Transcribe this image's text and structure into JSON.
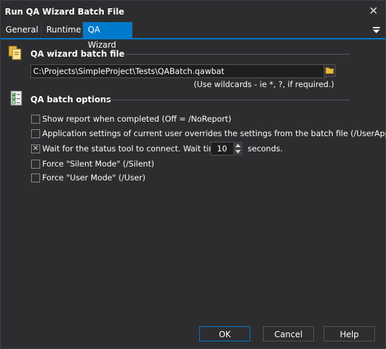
{
  "window": {
    "title": "Run QA Wizard Batch File"
  },
  "tabs": [
    {
      "label": "General"
    },
    {
      "label": "Runtime"
    },
    {
      "label": "QA Wizard"
    }
  ],
  "file_section": {
    "title": "QA wizard batch file",
    "path_value": "C:\\Projects\\SimpleProject\\Tests\\QABatch.qawbat",
    "hint": "(Use wildcards - ie *, ?, if required.)"
  },
  "options_section": {
    "title": "QA batch options",
    "options": [
      {
        "label": "Show report when completed (Off = /NoReport)",
        "checked": false
      },
      {
        "label": "Application settings of current user overrides the settings from the batch file (/UserApp)",
        "checked": false
      },
      {
        "label": "Wait for the status tool to connect. Wait timeout:",
        "checked": true
      },
      {
        "label": "Force \"Silent Mode\" (/Silent)",
        "checked": false
      },
      {
        "label": "Force \"User Mode\" (/User)",
        "checked": false
      }
    ],
    "timeout_value": "10",
    "timeout_suffix": "seconds."
  },
  "buttons": {
    "ok": "OK",
    "cancel": "Cancel",
    "help": "Help"
  },
  "colors": {
    "accent": "#007acc",
    "background": "#2d2d30",
    "input_bg": "#1e1e1e",
    "folder": "#e8b83a"
  },
  "icons": {
    "close": "close-icon",
    "tab_menu": "menu-icon",
    "file_section": "files-icon",
    "options_section": "checklist-icon",
    "browse": "folder-icon"
  }
}
